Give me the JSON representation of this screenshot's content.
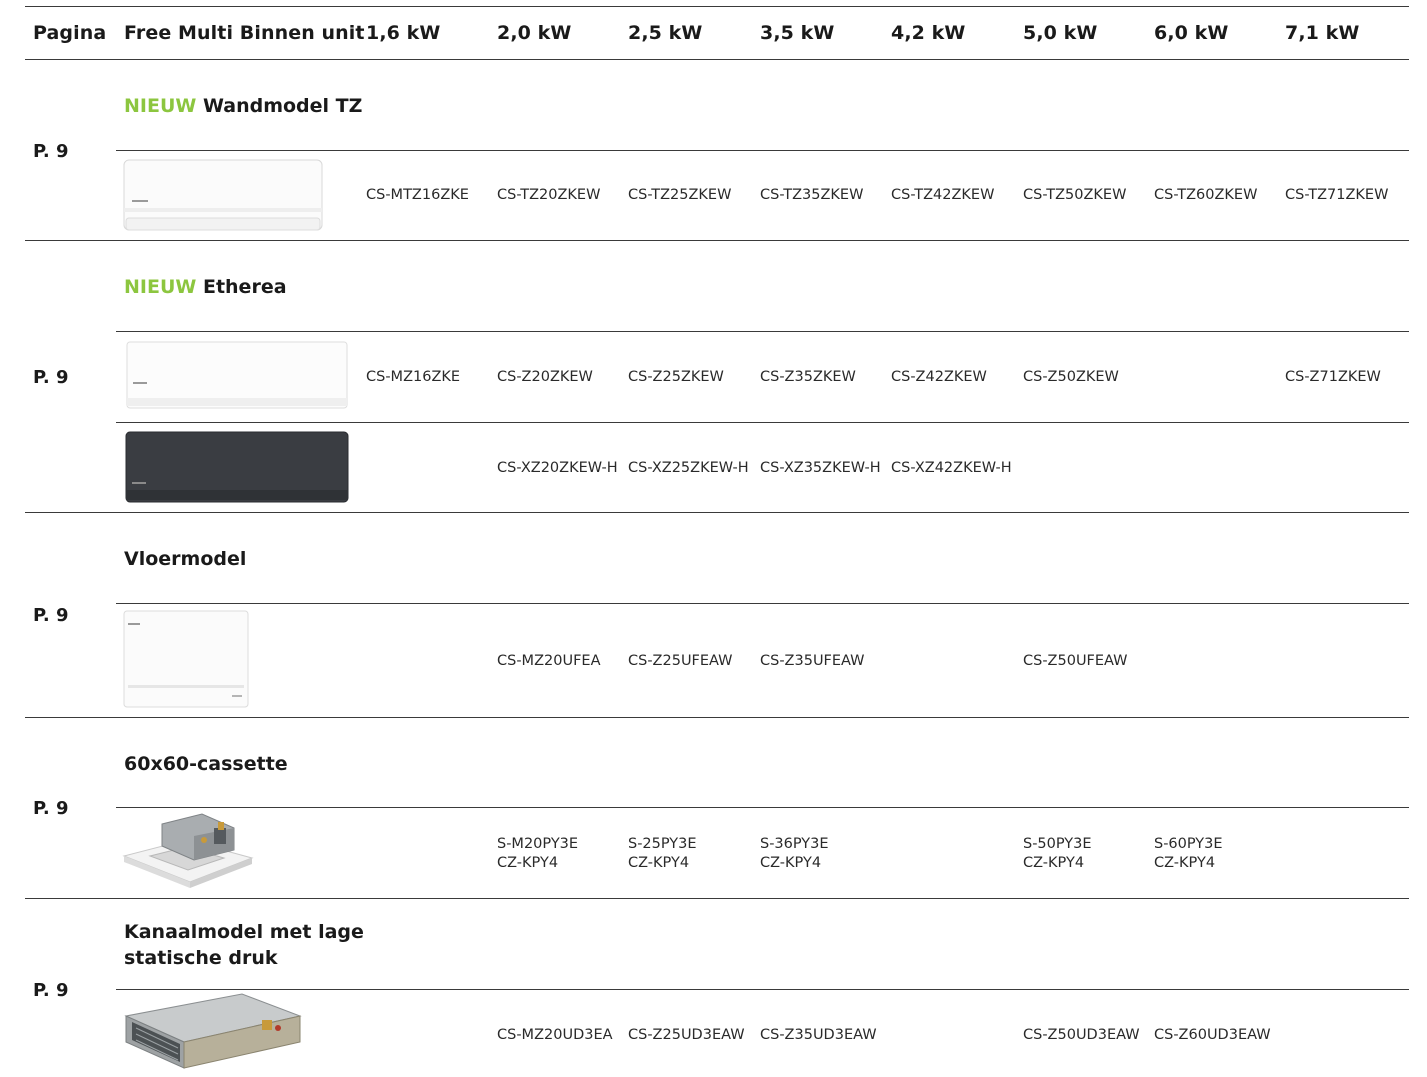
{
  "header": {
    "pagina": "Pagina",
    "unit_col": "Free Multi Binnen unit",
    "capacities": [
      "1,6 kW",
      "2,0 kW",
      "2,5 kW",
      "3,5 kW",
      "4,2 kW",
      "5,0 kW",
      "6,0 kW",
      "7,1 kW"
    ]
  },
  "sections": [
    {
      "page": "P. 9",
      "new_tag": "NIEUW",
      "title": "Wandmodel TZ",
      "rows": [
        {
          "image": "wall-unit-white",
          "codes": [
            "CS-MTZ16ZKE",
            "CS-TZ20ZKEW",
            "CS-TZ25ZKEW",
            "CS-TZ35ZKEW",
            "CS-TZ42ZKEW",
            "CS-TZ50ZKEW",
            "CS-TZ60ZKEW",
            "CS-TZ71ZKEW"
          ]
        }
      ]
    },
    {
      "page": "P. 9",
      "new_tag": "NIEUW",
      "title": "Etherea",
      "rows": [
        {
          "image": "etherea-white",
          "codes": [
            "CS-MZ16ZKE",
            "CS-Z20ZKEW",
            "CS-Z25ZKEW",
            "CS-Z35ZKEW",
            "CS-Z42ZKEW",
            "CS-Z50ZKEW",
            "",
            "CS-Z71ZKEW"
          ]
        },
        {
          "image": "etherea-graphite",
          "codes": [
            "",
            "CS-XZ20ZKEW-H",
            "CS-XZ25ZKEW-H",
            "CS-XZ35ZKEW-H",
            "CS-XZ42ZKEW-H",
            "",
            "",
            ""
          ]
        }
      ]
    },
    {
      "page": "P. 9",
      "title": "Vloermodel",
      "rows": [
        {
          "image": "floor-console",
          "codes": [
            "",
            "CS-MZ20UFEA",
            "CS-Z25UFEAW",
            "CS-Z35UFEAW",
            "",
            "CS-Z50UFEAW",
            "",
            ""
          ]
        }
      ]
    },
    {
      "page": "P. 9",
      "title": "60x60-cassette",
      "rows": [
        {
          "image": "cassette-60x60",
          "codes": [
            [
              "",
              ""
            ],
            [
              "S-M20PY3E",
              "CZ-KPY4"
            ],
            [
              "S-25PY3E",
              "CZ-KPY4"
            ],
            [
              "S-36PY3E",
              "CZ-KPY4"
            ],
            [
              "",
              ""
            ],
            [
              "S-50PY3E",
              "CZ-KPY4"
            ],
            [
              "S-60PY3E",
              "CZ-KPY4"
            ],
            [
              "",
              ""
            ]
          ]
        }
      ]
    },
    {
      "page": "P. 9",
      "title_lines": [
        "Kanaalmodel met lage",
        "statische druk"
      ],
      "rows": [
        {
          "image": "duct-low-static",
          "codes": [
            "",
            "CS-MZ20UD3EA",
            "CS-Z25UD3EAW",
            "CS-Z35UD3EAW",
            "",
            "CS-Z50UD3EAW",
            "CS-Z60UD3EAW",
            ""
          ]
        }
      ]
    }
  ]
}
